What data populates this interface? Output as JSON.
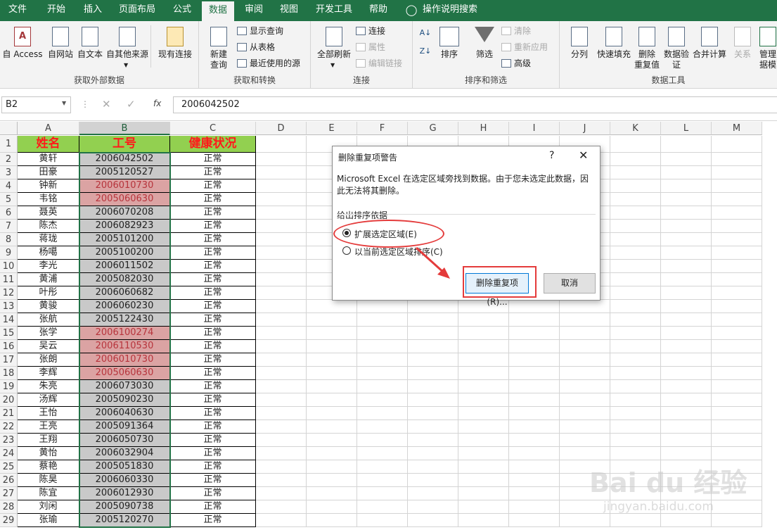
{
  "menu": {
    "tabs": [
      "文件",
      "开始",
      "插入",
      "页面布局",
      "公式",
      "数据",
      "审阅",
      "视图",
      "开发工具",
      "帮助"
    ],
    "active_tab": "数据",
    "tell_me": "操作说明搜索"
  },
  "ribbon": {
    "get_external": {
      "label": "获取外部数据",
      "from_access": "自 Access",
      "from_web": "自网站",
      "from_text": "自文本",
      "from_other": "自其他来源",
      "existing": "现有连接"
    },
    "get_transform": {
      "label": "获取和转换",
      "new_query_1": "新建",
      "new_query_2": "查询",
      "show_queries": "显示查询",
      "from_table": "从表格",
      "recent_sources": "最近使用的源"
    },
    "connections": {
      "label": "连接",
      "refresh_all": "全部刷新",
      "connections": "连接",
      "properties": "属性",
      "edit_links": "编辑链接"
    },
    "sort_filter": {
      "label": "排序和筛选",
      "sort": "排序",
      "filter": "筛选",
      "clear": "清除",
      "reapply": "重新应用",
      "advanced": "高级"
    },
    "data_tools": {
      "label": "数据工具",
      "text_to_columns": "分列",
      "flash_fill": "快速填充",
      "remove_dup_1": "删除",
      "remove_dup_2": "重复值",
      "validation_1": "数据验",
      "validation_2": "证",
      "consolidate": "合并计算",
      "relationships": "关系",
      "manage_1": "管理",
      "manage_2": "据模"
    }
  },
  "formula_bar": {
    "name_box": "B2",
    "fx": "fx",
    "content": "2006042502"
  },
  "sheet": {
    "columns": [
      "A",
      "B",
      "C",
      "D",
      "E",
      "F",
      "G",
      "H",
      "I",
      "J",
      "K",
      "L",
      "M"
    ],
    "headers": [
      "姓名",
      "工号",
      "健康状况"
    ],
    "rows": [
      {
        "n": "2",
        "name": "黄轩",
        "id": "2006042502",
        "status": "正常",
        "dup": false
      },
      {
        "n": "3",
        "name": "田豪",
        "id": "2005120527",
        "status": "正常",
        "dup": false
      },
      {
        "n": "4",
        "name": "钟新",
        "id": "2006010730",
        "status": "正常",
        "dup": true
      },
      {
        "n": "5",
        "name": "韦铭",
        "id": "2005060630",
        "status": "正常",
        "dup": true
      },
      {
        "n": "6",
        "name": "聂英",
        "id": "2006070208",
        "status": "正常",
        "dup": false
      },
      {
        "n": "7",
        "name": "陈杰",
        "id": "2006082923",
        "status": "正常",
        "dup": false
      },
      {
        "n": "8",
        "name": "蒋珑",
        "id": "2005101200",
        "status": "正常",
        "dup": false
      },
      {
        "n": "9",
        "name": "杨噶",
        "id": "2005100200",
        "status": "正常",
        "dup": false
      },
      {
        "n": "10",
        "name": "李光",
        "id": "2006011502",
        "status": "正常",
        "dup": false
      },
      {
        "n": "11",
        "name": "黄浦",
        "id": "2005082030",
        "status": "正常",
        "dup": false
      },
      {
        "n": "12",
        "name": "叶彤",
        "id": "2006060682",
        "status": "正常",
        "dup": false
      },
      {
        "n": "13",
        "name": "黄骏",
        "id": "2006060230",
        "status": "正常",
        "dup": false
      },
      {
        "n": "14",
        "name": "张航",
        "id": "2005122430",
        "status": "正常",
        "dup": false
      },
      {
        "n": "15",
        "name": "张学",
        "id": "2006100274",
        "status": "正常",
        "dup": true
      },
      {
        "n": "16",
        "name": "吴云",
        "id": "2006110530",
        "status": "正常",
        "dup": true
      },
      {
        "n": "17",
        "name": "张朗",
        "id": "2006010730",
        "status": "正常",
        "dup": true
      },
      {
        "n": "18",
        "name": "李辉",
        "id": "2005060630",
        "status": "正常",
        "dup": true
      },
      {
        "n": "19",
        "name": "朱亮",
        "id": "2006073030",
        "status": "正常",
        "dup": false
      },
      {
        "n": "20",
        "name": "汤辉",
        "id": "2005090230",
        "status": "正常",
        "dup": false
      },
      {
        "n": "21",
        "name": "王怡",
        "id": "2006040630",
        "status": "正常",
        "dup": false
      },
      {
        "n": "22",
        "name": "王亮",
        "id": "2005091364",
        "status": "正常",
        "dup": false
      },
      {
        "n": "23",
        "name": "王翔",
        "id": "2006050730",
        "status": "正常",
        "dup": false
      },
      {
        "n": "24",
        "name": "黄怡",
        "id": "2006032904",
        "status": "正常",
        "dup": false
      },
      {
        "n": "25",
        "name": "蔡艳",
        "id": "2005051830",
        "status": "正常",
        "dup": false
      },
      {
        "n": "26",
        "name": "陈昊",
        "id": "2006060330",
        "status": "正常",
        "dup": false
      },
      {
        "n": "27",
        "name": "陈宜",
        "id": "2006012930",
        "status": "正常",
        "dup": false
      },
      {
        "n": "28",
        "name": "刘闲",
        "id": "2005090738",
        "status": "正常",
        "dup": false
      },
      {
        "n": "29",
        "name": "张瑜",
        "id": "2005120270",
        "status": "正常",
        "dup": false
      }
    ],
    "header_row_number": "1"
  },
  "dialog": {
    "title": "删除重复项警告",
    "help": "?",
    "close": "✕",
    "message": "Microsoft Excel 在选定区域旁找到数据。由于您未选定此数据，因此无法将其删除。",
    "group_label": "给出排序依据",
    "option_expand": "扩展选定区域(E)",
    "option_current": "以当前选定区域排序(C)",
    "remove_button": "删除重复项(R)...",
    "cancel_button": "取消"
  },
  "watermark": {
    "brand": "Bai du 经验",
    "url": "jingyan.baidu.com"
  },
  "colors": {
    "excel_green": "#217346",
    "header_fill": "#92d050",
    "header_text": "#ff1a1a",
    "dup_fill": "#dba3a3",
    "dup_text": "#b7343c",
    "annotation_red": "#e43b3b"
  }
}
